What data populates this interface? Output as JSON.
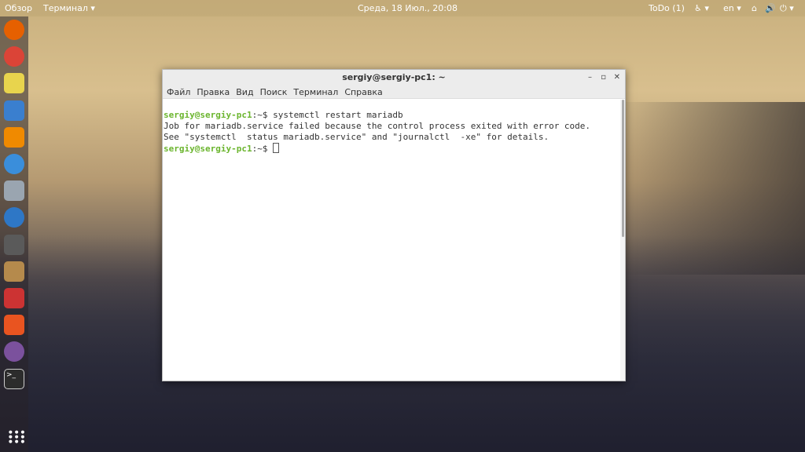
{
  "topbar": {
    "activities": "Обзор",
    "app_menu": "Терминал ▾",
    "clock": "Среда, 18 Июл., 20:08",
    "todo": "ToDo (1)",
    "lang": "en ▾",
    "accessibility_icon": "accessibility-icon",
    "network_icon": "network-icon",
    "volume_icon": "volume-icon",
    "power_icon": "power-icon"
  },
  "dock": {
    "items": [
      {
        "name": "firefox",
        "color": "#e66000"
      },
      {
        "name": "chrome",
        "color": "#db4437"
      },
      {
        "name": "rhythmbox",
        "color": "#e8d44d"
      },
      {
        "name": "libreoffice-writer",
        "color": "#3a7fcf"
      },
      {
        "name": "vlc",
        "color": "#f08a00"
      },
      {
        "name": "simplenote",
        "color": "#3a8edb"
      },
      {
        "name": "tools",
        "color": "#9aa5b0"
      },
      {
        "name": "thunderbird",
        "color": "#2e77c6"
      },
      {
        "name": "calculator",
        "color": "#5a5a5a"
      },
      {
        "name": "files-network",
        "color": "#b58a4c"
      },
      {
        "name": "installer",
        "color": "#c33"
      },
      {
        "name": "software-center",
        "color": "#e95420"
      },
      {
        "name": "viber",
        "color": "#7b519d"
      },
      {
        "name": "terminal",
        "color": "#2c2c2c"
      }
    ],
    "apps_icon": "apps-grid-icon"
  },
  "window": {
    "title": "sergiy@sergiy-pc1: ~",
    "minimize": "–",
    "maximize": "▫",
    "close": "✕",
    "menu": [
      "Файл",
      "Правка",
      "Вид",
      "Поиск",
      "Терминал",
      "Справка"
    ],
    "lines": [
      {
        "prompt": "sergiy@sergiy-pc1",
        "path": ":~$ ",
        "text": "systemctl restart mariadb"
      },
      {
        "text": "Job for mariadb.service failed because the control process exited with error code."
      },
      {
        "text": "See \"systemctl  status mariadb.service\" and \"journalctl  -xe\" for details."
      },
      {
        "prompt": "sergiy@sergiy-pc1",
        "path": ":~$ ",
        "text": ""
      }
    ]
  }
}
